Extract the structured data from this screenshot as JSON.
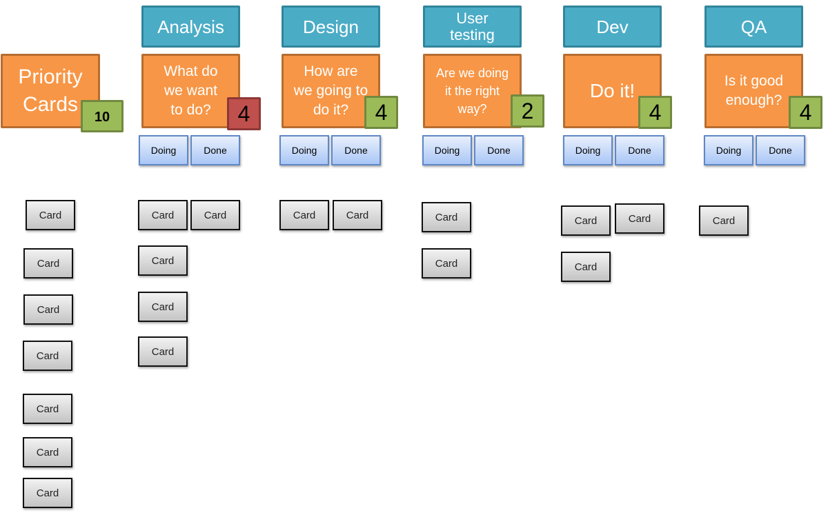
{
  "priority": {
    "title": "Priority Cards",
    "limit": "10"
  },
  "columns": [
    {
      "name": "Analysis",
      "question": "What do we want to do?",
      "wip_limit": "4",
      "limit_status": "exceeded",
      "doing_label": "Doing",
      "done_label": "Done"
    },
    {
      "name": "Design",
      "question": "How are we going to do it?",
      "wip_limit": "4",
      "limit_status": "ok",
      "doing_label": "Doing",
      "done_label": "Done"
    },
    {
      "name": "User testing",
      "question": "Are we doing it the right way?",
      "wip_limit": "2",
      "limit_status": "ok",
      "doing_label": "Doing",
      "done_label": "Done"
    },
    {
      "name": "Dev",
      "question": "Do it!",
      "wip_limit": "4",
      "limit_status": "ok",
      "doing_label": "Doing",
      "done_label": "Done"
    },
    {
      "name": "QA",
      "question": "Is it good enough?",
      "wip_limit": "4",
      "limit_status": "ok",
      "doing_label": "Doing",
      "done_label": "Done"
    }
  ],
  "card_label": "Card",
  "cards": {
    "priority": 7,
    "analysis": 5,
    "design": 2,
    "user_testing": 2,
    "dev": 3,
    "qa": 1
  },
  "colors": {
    "header": "#4bacc6",
    "question": "#f79646",
    "badge_ok": "#9bbb59",
    "badge_exceeded": "#c0504d",
    "state_button": "#c6d9f7"
  }
}
